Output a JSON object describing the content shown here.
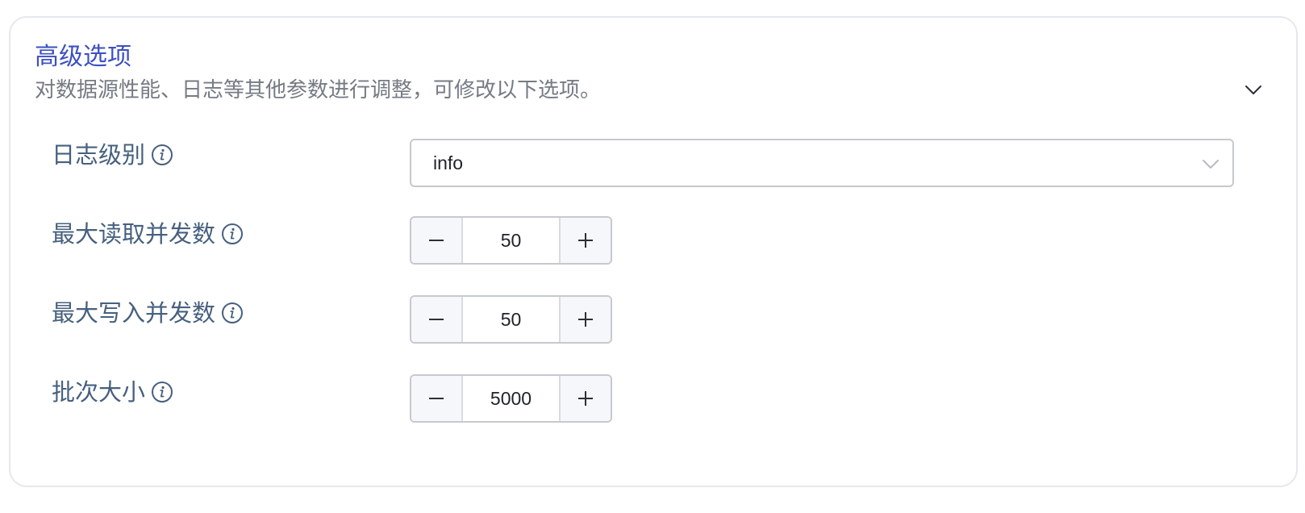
{
  "panel": {
    "title": "高级选项",
    "description": "对数据源性能、日志等其他参数进行调整，可修改以下选项。",
    "expanded": true
  },
  "log_level": {
    "label": "日志级别",
    "value": "info"
  },
  "max_read_concurrency": {
    "label": "最大读取并发数",
    "value": "50"
  },
  "max_write_concurrency": {
    "label": "最大写入并发数",
    "value": "50"
  },
  "batch_size": {
    "label": "批次大小",
    "value": "5000"
  },
  "icons": {
    "info": "info-circle-icon",
    "collapse": "chevron-down-icon",
    "select_arrow": "chevron-down-icon",
    "decrement": "minus-icon",
    "increment": "plus-icon"
  },
  "colors": {
    "title": "#3d50c2",
    "label": "#47607f",
    "description": "#767a83",
    "border": "#c6c9ce",
    "stepper_button_bg": "#f5f7fa"
  }
}
